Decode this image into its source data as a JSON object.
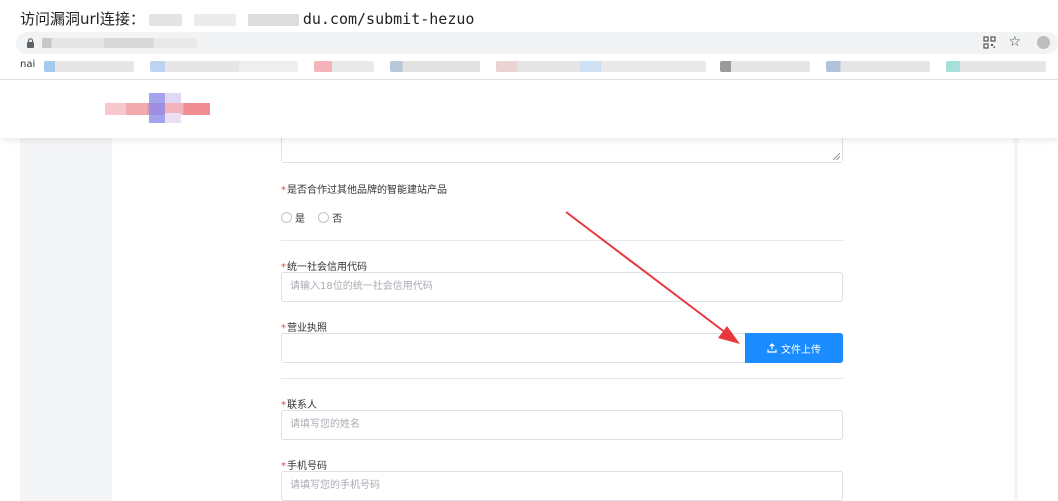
{
  "caption": {
    "label": "访问漏洞url连接：",
    "url_tail": "du.com/submit-hezuo"
  },
  "browser": {
    "bookmarks_lead": "nai"
  },
  "form": {
    "partner_question": {
      "required_mark": "*",
      "label": "是否合作过其他品牌的智能建站产品",
      "options": [
        "是",
        "否"
      ]
    },
    "credit_code": {
      "required_mark": "*",
      "label": "统一社会信用代码",
      "placeholder": "请输入18位的统一社会信用代码"
    },
    "business_license": {
      "required_mark": "*",
      "label": "营业执照",
      "upload_button": "文件上传"
    },
    "contact": {
      "required_mark": "*",
      "label": "联系人",
      "placeholder": "请填写您的姓名"
    },
    "phone": {
      "required_mark": "*",
      "label": "手机号码",
      "placeholder": "请填写您的手机号码"
    }
  },
  "colors": {
    "primary_button": "#1a8cff",
    "required_mark": "#f04545",
    "annotation_arrow": "#e8383d"
  },
  "icons": [
    "lock-icon",
    "qr-code-icon",
    "star-icon",
    "extension-icon",
    "upload-icon"
  ]
}
